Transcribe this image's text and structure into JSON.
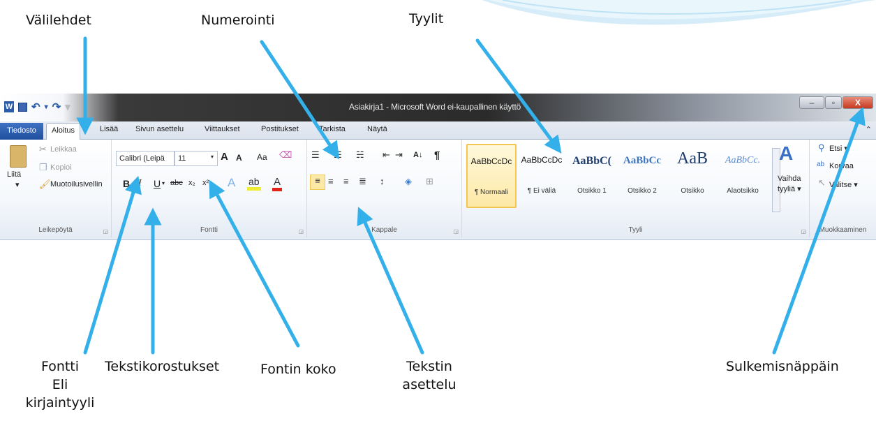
{
  "callouts": {
    "tabs": "Välilehdet",
    "numbering": "Numerointi",
    "styles": "Tyylit",
    "font_line1": "Fontti",
    "font_line2": "Eli",
    "font_line3": "kirjaintyyli",
    "text_emphasis": "Tekstikorostukset",
    "font_size": "Fontin koko",
    "text_layout_line1": "Tekstin",
    "text_layout_line2": "asettelu",
    "close_button": "Sulkemisnäppäin"
  },
  "window": {
    "title": "Asiakirja1 - Microsoft Word ei-kaupallinen käyttö",
    "close_glyph": "X",
    "help_glyph": "⌃"
  },
  "tabs": [
    "Tiedosto",
    "Aloitus",
    "Lisää",
    "Sivun asettelu",
    "Viittaukset",
    "Postitukset",
    "Tarkista",
    "Näytä"
  ],
  "clipboard": {
    "paste": "Liitä",
    "cut": "Leikkaa",
    "copy": "Kopioi",
    "format_painter": "Muotoilusivellin",
    "label": "Leikepöytä"
  },
  "font": {
    "name": "Calibri (Leipä",
    "size": "11",
    "bold": "B",
    "italic": "I",
    "underline": "U",
    "strike": "abc",
    "subscript": "x₂",
    "superscript": "x²",
    "grow": "A",
    "shrink": "A",
    "change_case": "Aa",
    "label": "Fontti"
  },
  "paragraph": {
    "sort": "A↓",
    "pilcrow": "¶",
    "label": "Kappale"
  },
  "styles": {
    "items": [
      {
        "preview": "AaBbCcDc",
        "name": "¶ Normaali"
      },
      {
        "preview": "AaBbCcDc",
        "name": "¶ Ei väliä"
      },
      {
        "preview": "AaBbC(",
        "name": "Otsikko 1"
      },
      {
        "preview": "AaBbCc",
        "name": "Otsikko 2"
      },
      {
        "preview": "AaB",
        "name": "Otsikko"
      },
      {
        "preview": "AaBbCc.",
        "name": "Alaotsikko"
      }
    ],
    "change_styles_line1": "Vaihda",
    "change_styles_line2": "tyyliä ▾",
    "label": "Tyyli"
  },
  "editing": {
    "find": "Etsi ▾",
    "replace": "Korvaa",
    "select": "Valitse ▾",
    "label": "Muokkaaminen"
  },
  "colors": {
    "arrow": "#33b0ea",
    "file_tab": "#2a5caa",
    "selected_style": "#f3c652"
  }
}
